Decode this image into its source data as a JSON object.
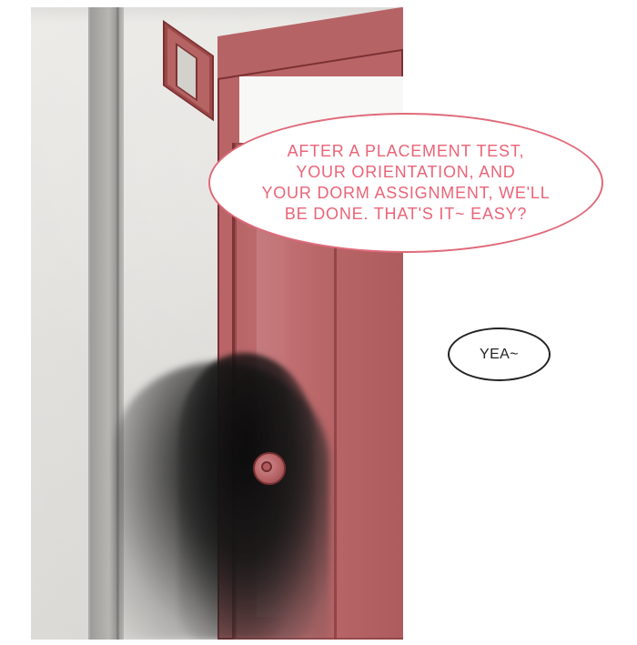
{
  "dialogue": {
    "main_bubble": "AFTER A PLACEMENT TEST,\nYOUR ORIENTATION, AND\nYOUR DORM ASSIGNMENT, WE'LL\nBE DONE. THAT'S IT~ EASY?",
    "reply_bubble": "YEA~"
  },
  "colors": {
    "speech_accent": "#ea6478",
    "door_red": "#b96567",
    "outline_dark": "#222222"
  }
}
